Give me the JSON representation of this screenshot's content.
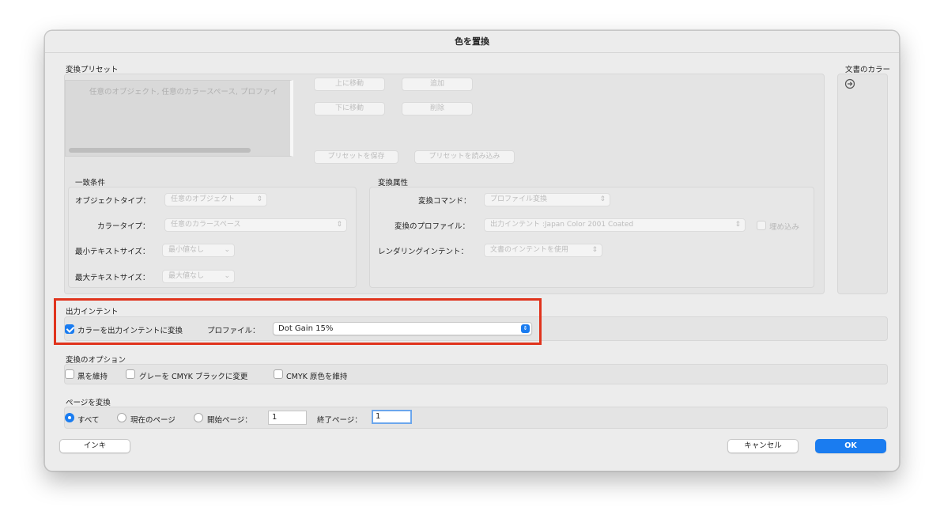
{
  "window": {
    "title": "色を置換"
  },
  "presets": {
    "section_label": "変換プリセット",
    "list_item": "任意のオブジェクト, 任意のカラースペース, プロファイ",
    "move_up": "上に移動",
    "move_down": "下に移動",
    "add": "追加",
    "delete": "削除",
    "save_preset": "プリセットを保存",
    "load_preset": "プリセットを読み込み"
  },
  "doc_colors": {
    "label": "文書のカラー"
  },
  "match": {
    "label": "一致条件",
    "object_type_label": "オブジェクトタイプ：",
    "object_type_value": "任意のオブジェクト",
    "color_type_label": "カラータイプ：",
    "color_type_value": "任意のカラースペース",
    "min_text_label": "最小テキストサイズ：",
    "min_text_value": "最小値なし",
    "max_text_label": "最大テキストサイズ：",
    "max_text_value": "最大値なし"
  },
  "convert_attrs": {
    "label": "変換属性",
    "command_label": "変換コマンド：",
    "command_value": "プロファイル変換",
    "profile_label": "変換のプロファイル：",
    "profile_value": "出力インテント :Japan Color 2001 Coated",
    "embed_label": "埋め込み",
    "intent_label": "レンダリングインテント：",
    "intent_value": "文書のインテントを使用"
  },
  "output_intent": {
    "label": "出力インテント",
    "checkbox_label": "カラーを出力インテントに変換",
    "checked": true,
    "profile_label": "プロファイル：",
    "profile_value": "Dot Gain 15%"
  },
  "convert_options": {
    "label": "変換のオプション",
    "keep_black": "黒を維持",
    "gray_to_black": "グレーを CMYK ブラックに変更",
    "keep_cmyk": "CMYK 原色を維持"
  },
  "pages": {
    "label": "ページを変換",
    "all": "すべて",
    "current": "現在のページ",
    "start_label": "開始ページ：",
    "start_value": "1",
    "end_label": "終了ページ：",
    "end_value": "1"
  },
  "footer": {
    "ink_button": "インキ",
    "cancel_button": "キャンセル",
    "ok_button": "OK"
  },
  "colors": {
    "accent": "#1a7cf0",
    "highlight": "#e0331c"
  }
}
